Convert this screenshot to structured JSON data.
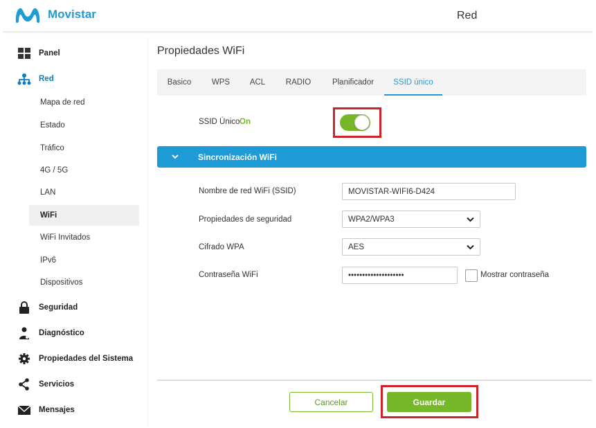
{
  "header": {
    "brand": "Movistar",
    "section_title": "Red"
  },
  "colors": {
    "brand_blue": "#1e9bd7",
    "active_green": "#76b82a",
    "highlight_red": "#d0222b"
  },
  "sidebar": {
    "main": [
      {
        "label": "Panel",
        "icon": "dashboard-grid-icon"
      },
      {
        "label": "Red",
        "icon": "network-icon",
        "active": true
      },
      {
        "label": "Seguridad",
        "icon": "lock-icon"
      },
      {
        "label": "Diagnóstico",
        "icon": "user-diagnostic-icon"
      },
      {
        "label": "Propiedades del Sistema",
        "icon": "gear-icon"
      },
      {
        "label": "Servicios",
        "icon": "share-icon"
      },
      {
        "label": "Mensajes",
        "icon": "envelope-icon"
      }
    ],
    "red_sub": [
      {
        "label": "Mapa de red"
      },
      {
        "label": "Estado"
      },
      {
        "label": "Tráfico"
      },
      {
        "label": "4G / 5G"
      },
      {
        "label": "LAN"
      },
      {
        "label": "WiFi",
        "active": true
      },
      {
        "label": "WiFi Invitados"
      },
      {
        "label": "IPv6"
      },
      {
        "label": "Dispositivos"
      }
    ]
  },
  "main": {
    "title": "Propiedades WiFi",
    "tabs": [
      {
        "label": "Basico"
      },
      {
        "label": "WPS"
      },
      {
        "label": "ACL"
      },
      {
        "label": "RADIO"
      },
      {
        "label": "Planificador"
      },
      {
        "label": "SSID único",
        "active": true
      }
    ],
    "ssid_unico": {
      "label": "SSID Único",
      "state_text": "On",
      "enabled": true
    },
    "sync_section": {
      "title": "Sincronización WiFi",
      "expanded": true
    },
    "form": {
      "ssid_label": "Nombre de red WiFi (SSID)",
      "ssid_value": "MOVISTAR-WIFI6-D424",
      "security_label": "Propiedades de seguridad",
      "security_value": "WPA2/WPA3",
      "cipher_label": "Cifrado WPA",
      "cipher_value": "AES",
      "password_label": "Contraseña WiFi",
      "password_value": "••••••••••••••••••••",
      "show_password_label": "Mostrar contraseña",
      "show_password_checked": false
    },
    "actions": {
      "cancel_label": "Cancelar",
      "save_label": "Guardar"
    }
  }
}
